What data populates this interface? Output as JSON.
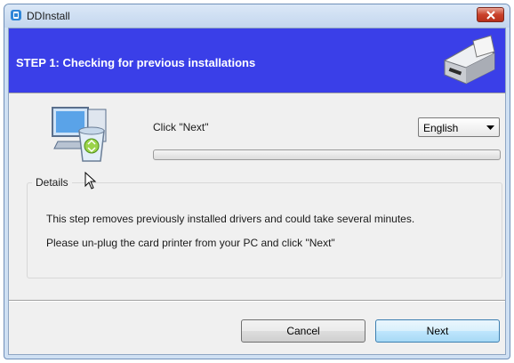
{
  "window": {
    "title": "DDInstall"
  },
  "header": {
    "step_title": "STEP 1: Checking for previous installations",
    "banner_color": "#3a3fe8"
  },
  "main": {
    "instruction": "Click \"Next\"",
    "language": {
      "selected": "English"
    },
    "progress": {
      "fraction": 0.0
    },
    "details": {
      "legend": "Details",
      "line1": "This step removes previously installed drivers and could take several minutes.",
      "line2": "Please un-plug the card printer from your PC and click \"Next\""
    }
  },
  "footer": {
    "cancel_label": "Cancel",
    "next_label": "Next"
  },
  "icons": {
    "app": "app-icon",
    "close": "close-icon",
    "printer": "card-printer-icon",
    "computer": "computer-recycle-icon",
    "dropdown": "chevron-down-icon",
    "cursor": "mouse-cursor-icon"
  }
}
